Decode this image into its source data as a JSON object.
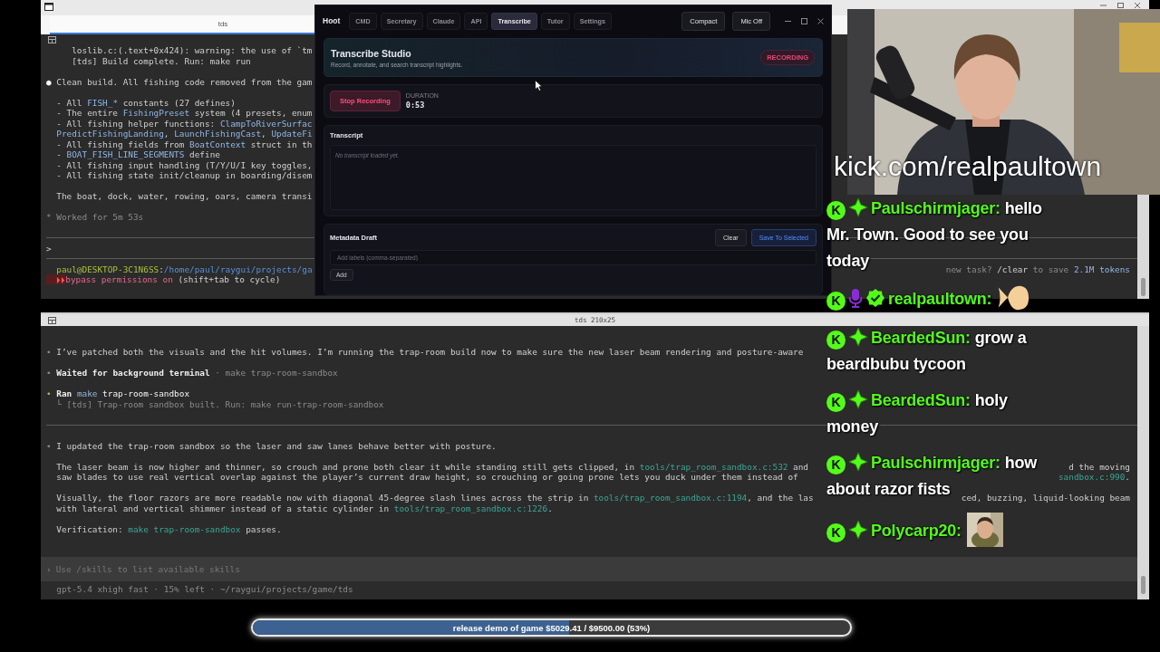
{
  "terminal_top": {
    "tab": "tds",
    "lines": [
      {
        "kind": "text",
        "segments": [
          {
            "text": "     loslib.c:(.text+0x424): warning: the use of `tm",
            "kind": "plain"
          }
        ]
      },
      {
        "kind": "text",
        "segments": [
          {
            "text": "     [tds] Build complete. Run: make run",
            "kind": "plain"
          }
        ]
      },
      {
        "kind": "blank"
      },
      {
        "kind": "text",
        "segments": [
          {
            "text": "● ",
            "kind": "bright"
          },
          {
            "text": "Clean build. All fishing code removed from the gam",
            "kind": "plain"
          }
        ]
      },
      {
        "kind": "blank"
      },
      {
        "kind": "text",
        "segments": [
          {
            "text": "  - All ",
            "kind": "plain"
          },
          {
            "text": "FISH_*",
            "kind": "code"
          },
          {
            "text": " constants (27 defines)",
            "kind": "plain"
          }
        ]
      },
      {
        "kind": "text",
        "segments": [
          {
            "text": "  - The entire ",
            "kind": "plain"
          },
          {
            "text": "FishingPreset",
            "kind": "code"
          },
          {
            "text": " system (4 presets, enum",
            "kind": "plain"
          }
        ]
      },
      {
        "kind": "text",
        "segments": [
          {
            "text": "  - All fishing helper functions: ",
            "kind": "plain"
          },
          {
            "text": "ClampToRiverSurfac",
            "kind": "code"
          }
        ]
      },
      {
        "kind": "text",
        "segments": [
          {
            "text": "  PredictFishingLanding",
            "kind": "code"
          },
          {
            "text": ", ",
            "kind": "plain"
          },
          {
            "text": "LaunchFishingCast",
            "kind": "code"
          },
          {
            "text": ", ",
            "kind": "plain"
          },
          {
            "text": "UpdateFi",
            "kind": "code"
          }
        ]
      },
      {
        "kind": "text",
        "segments": [
          {
            "text": "  - All fishing fields from ",
            "kind": "plain"
          },
          {
            "text": "BoatContext",
            "kind": "code"
          },
          {
            "text": " struct in th",
            "kind": "plain"
          }
        ]
      },
      {
        "kind": "text",
        "segments": [
          {
            "text": "  - ",
            "kind": "plain"
          },
          {
            "text": "BOAT_FISH_LINE_SEGMENTS",
            "kind": "code"
          },
          {
            "text": " define",
            "kind": "plain"
          }
        ]
      },
      {
        "kind": "text",
        "segments": [
          {
            "text": "  - All fishing input handling (T/Y/U/I key toggles,",
            "kind": "plain"
          }
        ]
      },
      {
        "kind": "text",
        "segments": [
          {
            "text": "  - All fishing state init/cleanup in boarding/disem",
            "kind": "plain"
          }
        ]
      },
      {
        "kind": "blank"
      },
      {
        "kind": "text",
        "segments": [
          {
            "text": "  The boat, dock, water, rowing, oars, camera transi",
            "kind": "plain"
          }
        ]
      },
      {
        "kind": "blank"
      },
      {
        "kind": "text",
        "segments": [
          {
            "text": "* Worked for 5m 53s",
            "kind": "dim"
          }
        ]
      },
      {
        "kind": "blank"
      },
      {
        "kind": "rule"
      },
      {
        "kind": "text",
        "segments": [
          {
            "text": ">",
            "kind": "plain"
          }
        ]
      },
      {
        "kind": "rule"
      },
      {
        "kind": "text",
        "segments": [
          {
            "text": "  paul@DESKTOP-3C1N6SS",
            "kind": "user"
          },
          {
            "text": ":",
            "kind": "plain"
          },
          {
            "text": "/home/paul/raygui/projects/ga",
            "kind": "dir"
          }
        ],
        "right": [
          {
            "text": "new task? ",
            "kind": "dim"
          },
          {
            "text": "/clear",
            "kind": "plain"
          },
          {
            "text": " to save ",
            "kind": "dim"
          },
          {
            "text": "2.1M tokens",
            "kind": "code"
          }
        ]
      },
      {
        "kind": "text",
        "segments": [
          {
            "text": "  ⏵⏵",
            "kind": "warn"
          },
          {
            "text": "bypass permissions on",
            "kind": "alert"
          },
          {
            "text": " (shift+tab to cycle)",
            "kind": "plain"
          }
        ]
      }
    ]
  },
  "hoot": {
    "brand": "Hoot",
    "tabs": [
      {
        "label": "CMD",
        "selected": false
      },
      {
        "label": "Secretary",
        "selected": false
      },
      {
        "label": "Claude",
        "selected": false
      },
      {
        "label": "API",
        "selected": false
      },
      {
        "label": "Transcribe",
        "selected": true
      },
      {
        "label": "Tutor",
        "selected": false
      },
      {
        "label": "Settings",
        "selected": false
      }
    ],
    "buttons": [
      "Compact",
      "Mic Off"
    ],
    "header": {
      "title": "Transcribe Studio",
      "subtitle": "Record, annotate, and search transcript highlights.",
      "badge": "RECORDING"
    },
    "recorder": {
      "button": "Stop Recording",
      "duration_label": "DURATION",
      "duration": "0:53"
    },
    "transcript": {
      "title": "Transcript",
      "placeholder": "No transcript loaded yet."
    },
    "metadata": {
      "title": "Metadata Draft",
      "buttons": [
        {
          "label": "Clear",
          "kind": "plain"
        },
        {
          "label": "Save To Selected",
          "kind": "primary"
        }
      ],
      "placeholder": "Add labels (comma-separated)",
      "add_button": "Add"
    }
  },
  "terminal_bottom": {
    "title": "tds 210x25",
    "lines": [
      {
        "kind": "text",
        "segments": [
          {
            "text": "• ",
            "kind": "dim"
          },
          {
            "text": "I’ve patched both the visuals and the hit volumes. I’m running the trap-room build now to make sure the new laser beam rendering and posture-aware",
            "kind": "plain"
          }
        ]
      },
      {
        "kind": "blank"
      },
      {
        "kind": "text",
        "segments": [
          {
            "text": "• ",
            "kind": "dim"
          },
          {
            "text": "Waited for background terminal",
            "kind": "bold"
          },
          {
            "text": " · make trap-room-sandbox",
            "kind": "dim"
          }
        ]
      },
      {
        "kind": "blank"
      },
      {
        "kind": "text",
        "segments": [
          {
            "text": "• ",
            "kind": "user"
          },
          {
            "text": "Ran ",
            "kind": "bold"
          },
          {
            "text": "make",
            "kind": "code"
          },
          {
            "text": " trap-room-sandbox",
            "kind": "bright"
          }
        ]
      },
      {
        "kind": "text",
        "segments": [
          {
            "text": "  └ [tds] Trap-room sandbox built. Run: make run-trap-room-sandbox",
            "kind": "dim"
          }
        ]
      },
      {
        "kind": "blank"
      },
      {
        "kind": "rule"
      },
      {
        "kind": "blank"
      },
      {
        "kind": "text",
        "segments": [
          {
            "text": "• ",
            "kind": "dim"
          },
          {
            "text": "I updated the trap-room sandbox so the laser and saw lanes behave better with posture.",
            "kind": "plain"
          }
        ]
      },
      {
        "kind": "blank"
      },
      {
        "kind": "text",
        "segments": [
          {
            "text": "  The laser beam is now higher and thinner, so crouch and prone both clear it while standing still gets clipped, in ",
            "kind": "plain"
          },
          {
            "text": "tools/trap_room_sandbox.c:532",
            "kind": "path"
          },
          {
            "text": " and",
            "kind": "plain"
          }
        ],
        "right": [
          {
            "text": "d the moving",
            "kind": "plain"
          }
        ]
      },
      {
        "kind": "text",
        "segments": [
          {
            "text": "  saw blades to use real vertical overlap against the player’s current draw height, so crouching or going prone lets you duck under them instead of",
            "kind": "plain"
          }
        ],
        "right": [
          {
            "text": "sandbox.c:990",
            "kind": "path"
          },
          {
            "text": ".",
            "kind": "plain"
          }
        ]
      },
      {
        "kind": "blank"
      },
      {
        "kind": "text",
        "segments": [
          {
            "text": "  Visually, the floor razors are more readable now with diagonal 45-degree slash lines across the strip in ",
            "kind": "plain"
          },
          {
            "text": "tools/trap_room_sandbox.c:1194",
            "kind": "path"
          },
          {
            "text": ", and the las",
            "kind": "plain"
          }
        ],
        "right": [
          {
            "text": "ced, buzzing, liquid-looking beam",
            "kind": "plain"
          }
        ]
      },
      {
        "kind": "text",
        "segments": [
          {
            "text": "  with lateral and vertical shimmer instead of a static cylinder in ",
            "kind": "plain"
          },
          {
            "text": "tools/trap_room_sandbox.c:1226",
            "kind": "path"
          },
          {
            "text": ".",
            "kind": "plain"
          }
        ]
      },
      {
        "kind": "blank"
      },
      {
        "kind": "text",
        "segments": [
          {
            "text": "  Verification: ",
            "kind": "plain"
          },
          {
            "text": "make trap-room-sandbox",
            "kind": "path"
          },
          {
            "text": " passes.",
            "kind": "plain"
          }
        ]
      }
    ],
    "input": {
      "prompt": "›",
      "placeholder": "Use /skills to list available skills"
    },
    "status": "  gpt-5.4 xhigh fast · 15% left · ~/raygui/projects/game/tds"
  },
  "stream": {
    "channel": "kick.com/realpaultown",
    "chat": [
      {
        "badges": [
          {
            "kind": "kick",
            "label": "K"
          },
          {
            "kind": "gem"
          }
        ],
        "user": "Paulschirmjager:",
        "text": [
          "hello",
          "Mr. Town. Good to see you",
          "today"
        ]
      },
      {
        "badges": [
          {
            "kind": "kick",
            "label": "K"
          },
          {
            "kind": "mic"
          },
          {
            "kind": "verified"
          }
        ],
        "user": "realpaultown:",
        "emote": {
          "kind": "blob"
        }
      },
      {
        "badges": [
          {
            "kind": "kick",
            "label": "K"
          },
          {
            "kind": "gem"
          }
        ],
        "user": "BeardedSun:",
        "text": [
          "grow a",
          "beardbubu tycoon"
        ]
      },
      {
        "badges": [
          {
            "kind": "kick",
            "label": "K"
          },
          {
            "kind": "gem"
          }
        ],
        "user": "BeardedSun:",
        "text": [
          "holy",
          "money"
        ]
      },
      {
        "badges": [
          {
            "kind": "kick",
            "label": "K"
          },
          {
            "kind": "gem"
          }
        ],
        "user": "Paulschirmjager:",
        "text": [
          "how",
          "about razor fists"
        ]
      },
      {
        "badges": [
          {
            "kind": "kick",
            "label": "K"
          },
          {
            "kind": "gem"
          }
        ],
        "user": "Polycarp20:",
        "emote": {
          "kind": "picture"
        }
      }
    ]
  },
  "goal": {
    "text": "release demo of game $5029.41 / $9500.00 (53%)",
    "level": 0.53
  }
}
